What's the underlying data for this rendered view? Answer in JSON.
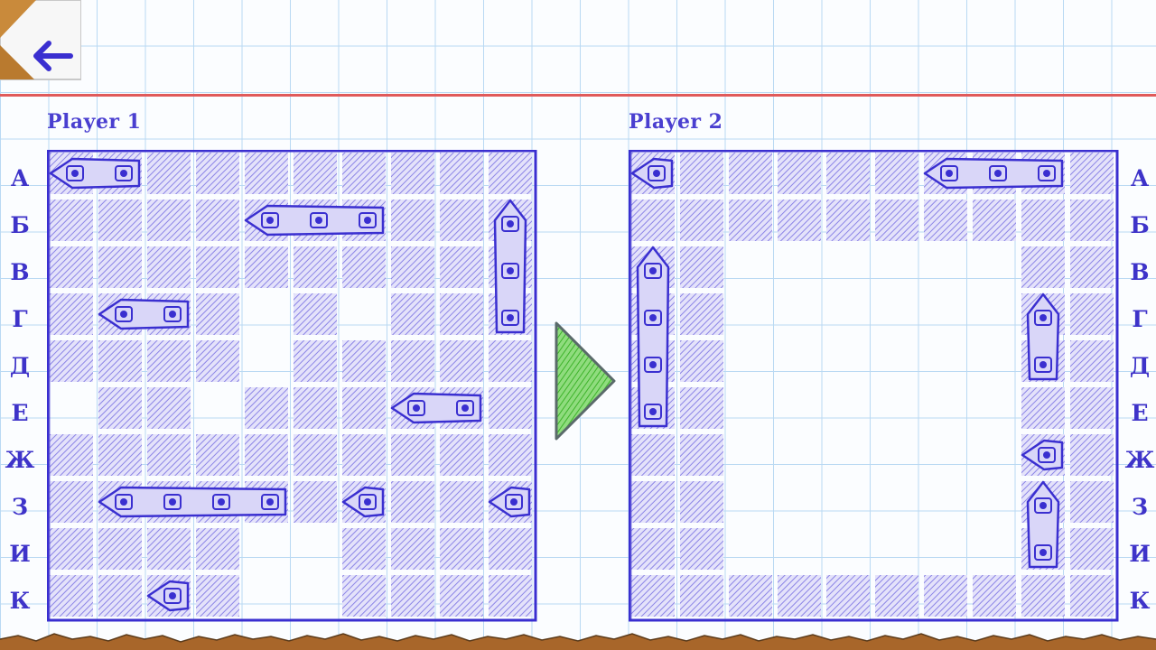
{
  "players": [
    {
      "name": "Player 1"
    },
    {
      "name": "Player 2"
    }
  ],
  "row_labels": [
    "А",
    "Б",
    "В",
    "Г",
    "Д",
    "Е",
    "Ж",
    "З",
    "И",
    "К"
  ],
  "colors": {
    "ink": "#3a2fd0",
    "hatch": "#8b84e6",
    "margin_line": "#e05a5a",
    "play_arrow": "#5cc94a"
  },
  "icons": {
    "back": "arrow-left-icon",
    "play": "play-triangle-icon"
  }
}
